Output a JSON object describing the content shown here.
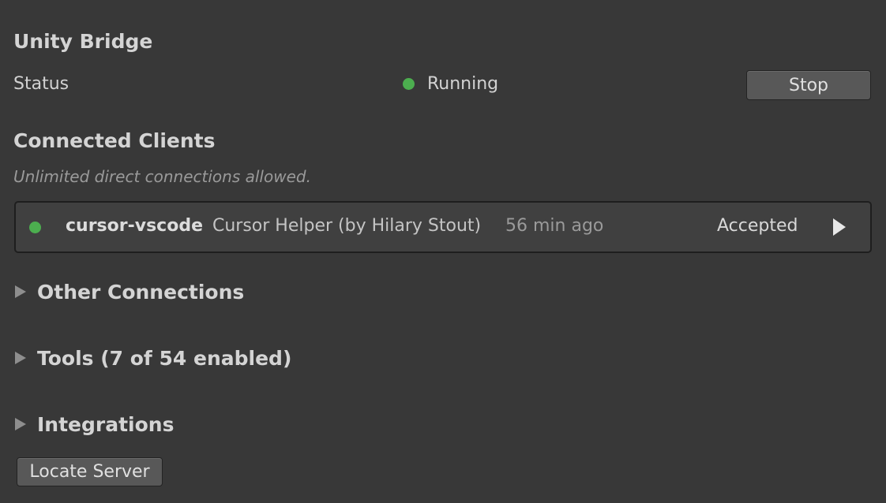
{
  "colors": {
    "background": "#383838",
    "status_running": "#4cae4f",
    "client_connected": "#4cae4f"
  },
  "bridge": {
    "title": "Unity Bridge",
    "status_label": "Status",
    "status_value": "Running",
    "stop_label": "Stop"
  },
  "clients": {
    "title": "Connected Clients",
    "subtitle": "Unlimited direct connections allowed.",
    "items": [
      {
        "name": "cursor-vscode",
        "description": "Cursor Helper (by Hilary Stout)",
        "time": "56 min ago",
        "status": "Accepted",
        "icon": "play-icon"
      }
    ]
  },
  "sections": {
    "other_connections": "Other Connections",
    "tools": "Tools (7 of 54 enabled)",
    "integrations": "Integrations"
  },
  "locate_server_label": "Locate Server"
}
